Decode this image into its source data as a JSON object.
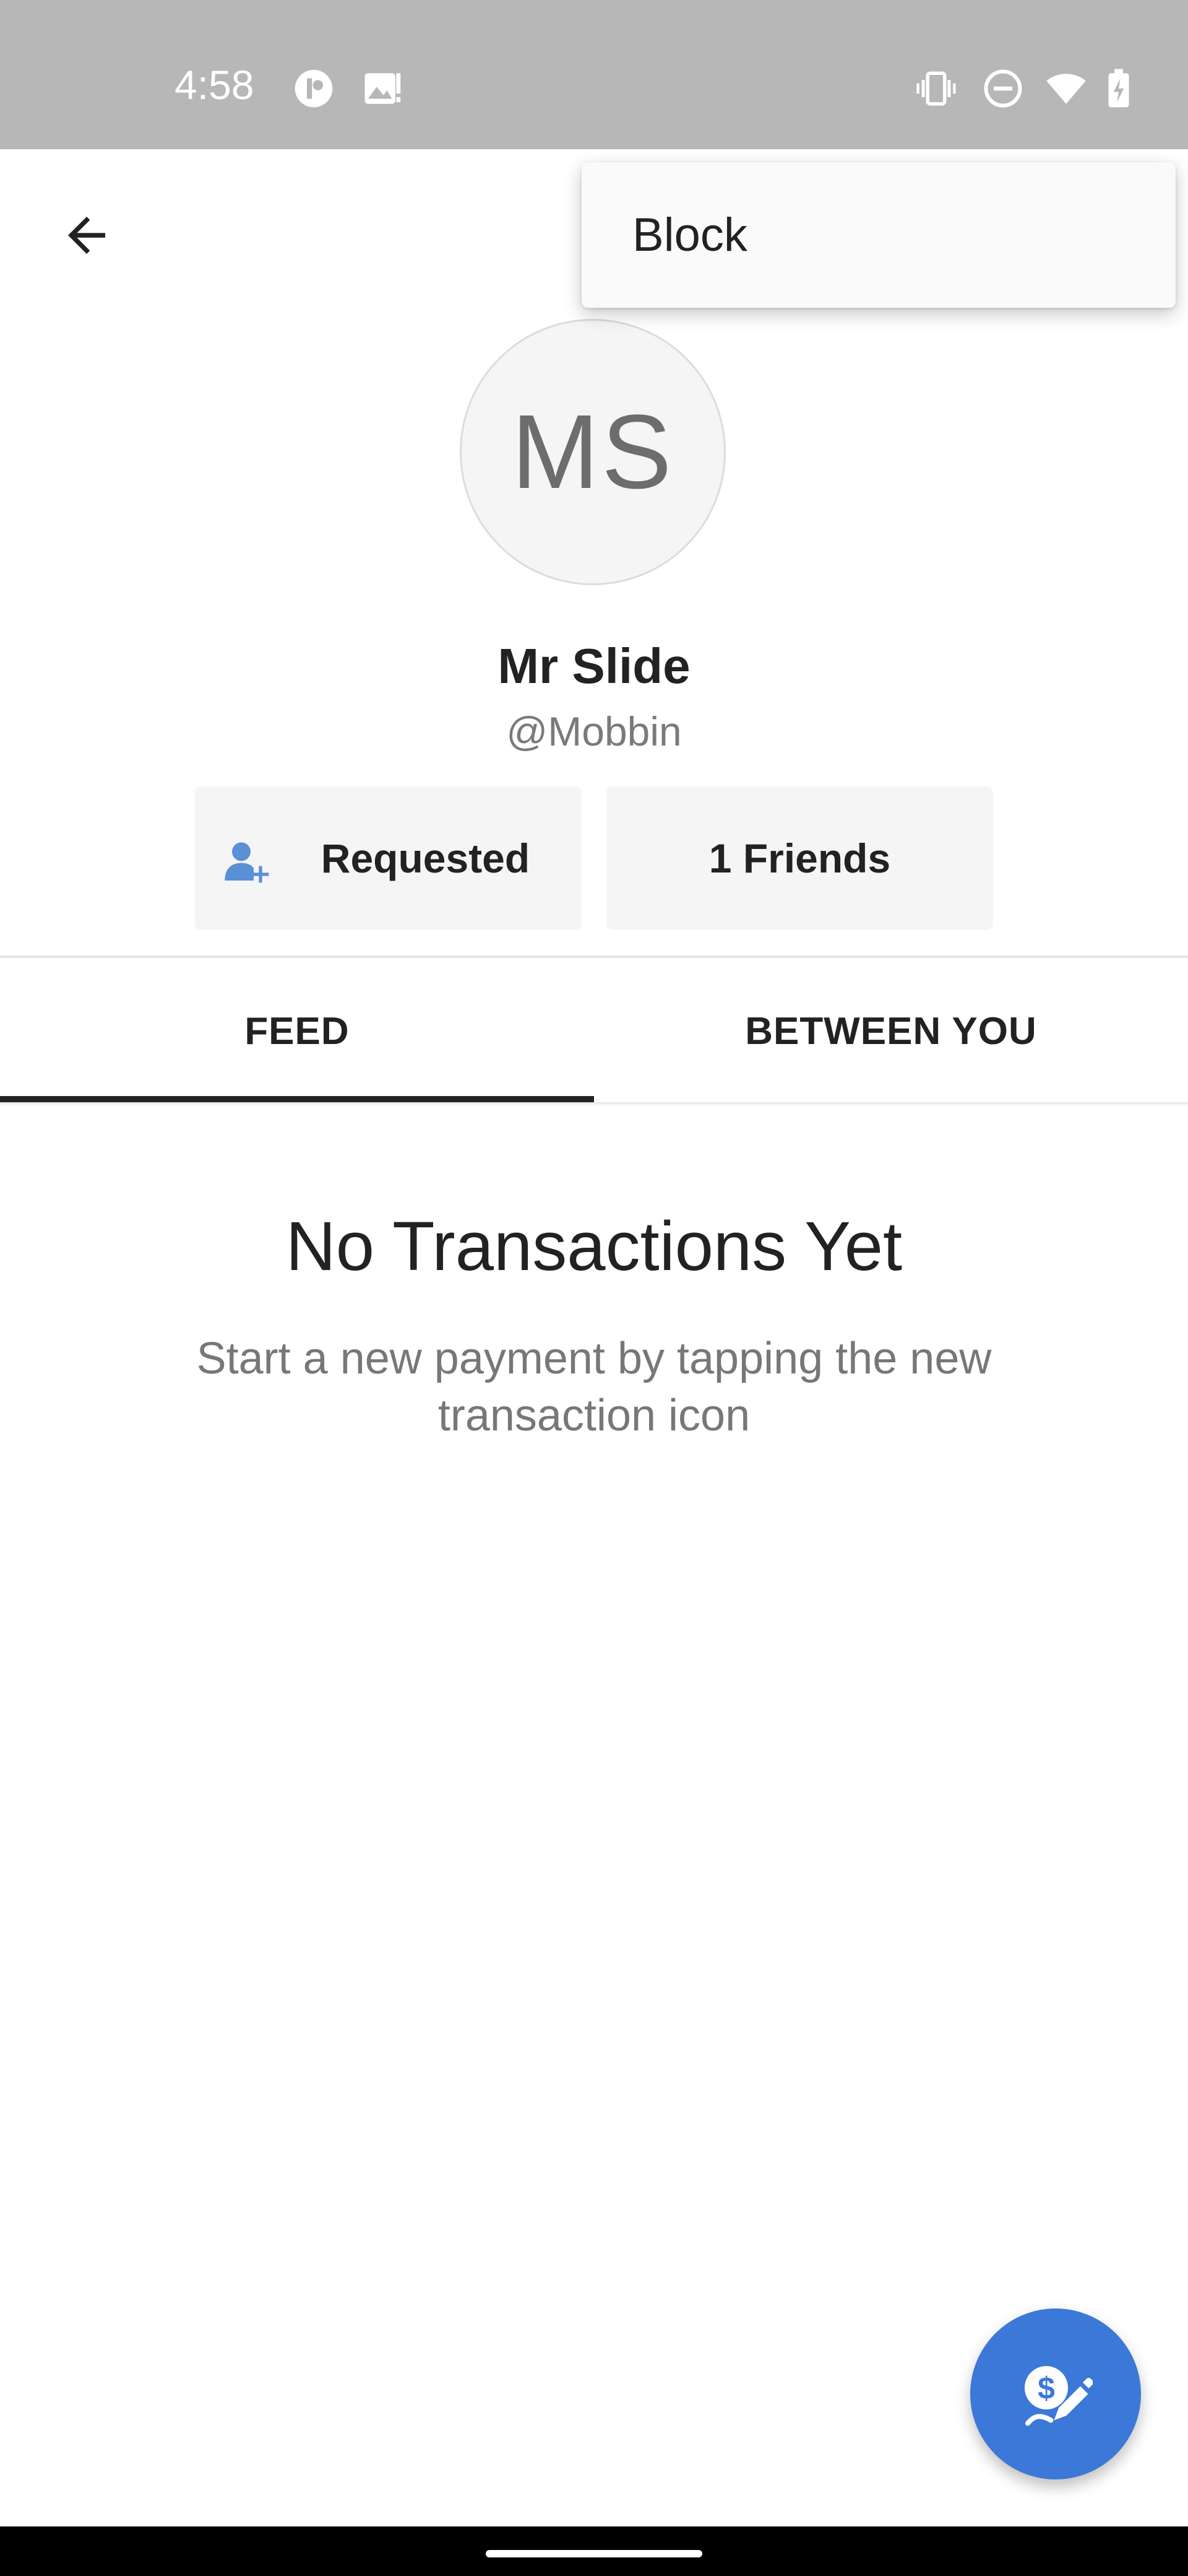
{
  "status_bar": {
    "time": "4:58",
    "left_icons": [
      "app-notification-icon",
      "image-notification-icon"
    ],
    "right_icons": [
      "vibrate-icon",
      "do-not-disturb-icon",
      "wifi-icon",
      "battery-charging-icon"
    ]
  },
  "app_bar": {
    "back_icon": "arrow-left-icon"
  },
  "menu": {
    "items": [
      {
        "label": "Block"
      }
    ]
  },
  "profile": {
    "initials": "MS",
    "name": "Mr Slide",
    "handle": "@Mobbin"
  },
  "actions": {
    "requested_label": "Requested",
    "requested_icon": "person-add-icon",
    "friends_label": "1 Friends"
  },
  "tabs": [
    {
      "label": "FEED",
      "selected": true
    },
    {
      "label": "BETWEEN YOU",
      "selected": false
    }
  ],
  "empty_state": {
    "title": "No Transactions Yet",
    "subtitle": "Start a new payment by tapping the new transaction icon"
  },
  "fab": {
    "icon": "new-transaction-icon"
  },
  "colors": {
    "status_bar": "#b7b7b7",
    "accent": "#3b78d8",
    "text_primary": "#222222",
    "text_secondary": "#777777",
    "button_bg": "#f5f5f5",
    "icon_blue": "#5b8fd6"
  }
}
